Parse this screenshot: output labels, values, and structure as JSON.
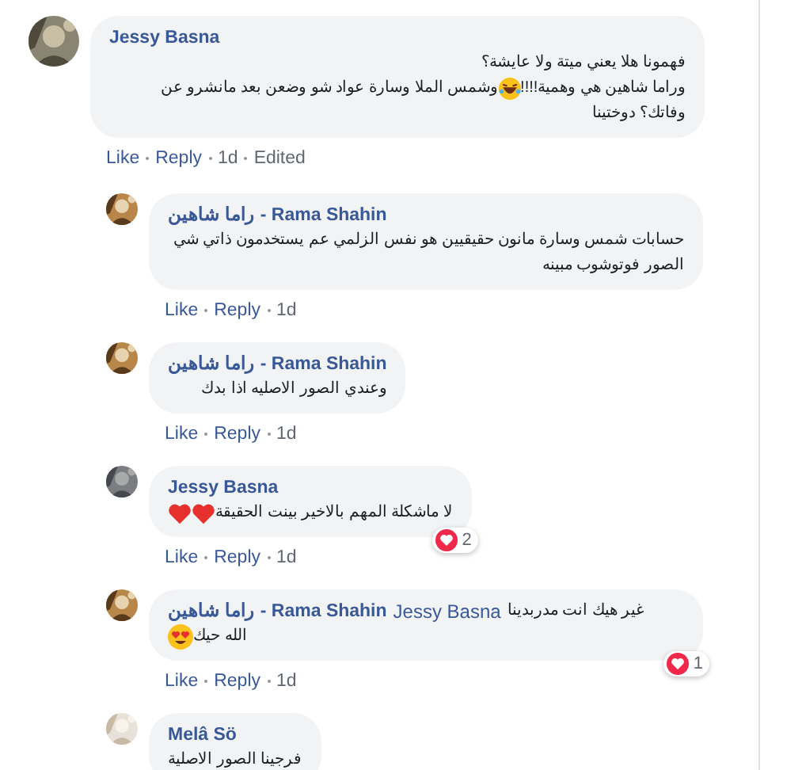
{
  "comment": {
    "author": "Jessy Basna",
    "avatar": {
      "kind": "picture"
    },
    "lines": [
      [
        {
          "kind": "text",
          "text": "فهمونا هلا يعني ميتة ولا عايشة؟"
        }
      ],
      [
        {
          "kind": "text",
          "text": "وراما شاهين هي وهمية!!!!"
        },
        {
          "kind": "laugh"
        },
        {
          "kind": "text",
          "text": "وشمس الملا وسارة عواد شو وضعن بعد مانشرو عن"
        }
      ],
      [
        {
          "kind": "text",
          "text": "وفاتك؟ دوختينا"
        }
      ]
    ],
    "like": "Like",
    "reply": "Reply",
    "time": "1d",
    "edited_label": "Edited",
    "replies": [
      {
        "author": "راما شاهين - Rama Shahin",
        "avatar": {
          "kind": "picture"
        },
        "lines": [
          [
            {
              "kind": "text",
              "text": "حسابات شمس وسارة مانون حقيقيين هو نفس الزلمي عم يستخدمون ذاتي شي"
            }
          ],
          [
            {
              "kind": "text",
              "text": "الصور فوتوشوب مبينه"
            }
          ]
        ],
        "like": "Like",
        "reply": "Reply",
        "time": "1d"
      },
      {
        "author": "راما شاهين - Rama Shahin",
        "avatar": {
          "kind": "picture"
        },
        "lines": [
          [
            {
              "kind": "text",
              "text": "وعندي الصور الاصليه اذا بدك"
            }
          ]
        ],
        "like": "Like",
        "reply": "Reply",
        "time": "1d"
      },
      {
        "author": "Jessy Basna",
        "avatar": {
          "kind": "picture"
        },
        "lines": [
          [
            {
              "kind": "text",
              "text": "لا ماشكلة المهم بالاخير بينت الحقيقة"
            },
            {
              "kind": "heart"
            },
            {
              "kind": "heart"
            }
          ]
        ],
        "reaction_count": "2",
        "like": "Like",
        "reply": "Reply",
        "time": "1d"
      },
      {
        "author": "راما شاهين - Rama Shahin",
        "mention": "Jessy Basna",
        "first_line_text": "غير هيك انت مدربدينا",
        "lines": [
          [
            {
              "kind": "text",
              "text": "الله حيك"
            },
            {
              "kind": "heart-eyes"
            }
          ]
        ],
        "avatar": {
          "kind": "picture"
        },
        "reaction_count": "1",
        "like": "Like",
        "reply": "Reply",
        "time": "1d"
      },
      {
        "author": "Melâ Sö",
        "avatar": {
          "kind": "picture"
        },
        "lines": [
          [
            {
              "kind": "text",
              "text": "فرجينا الصور الاصلية"
            }
          ]
        ]
      }
    ]
  }
}
